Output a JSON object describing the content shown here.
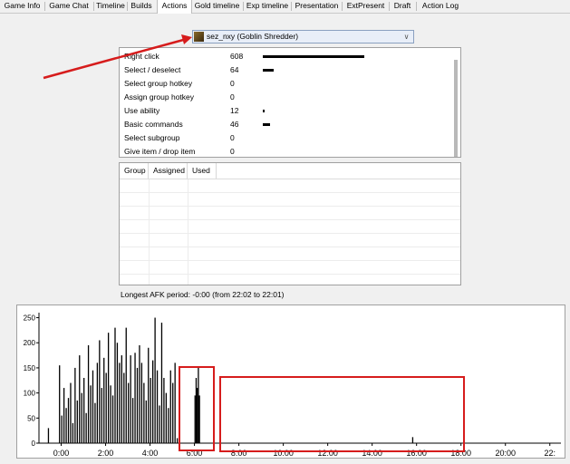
{
  "tabs": [
    "Game Info",
    "Game Chat",
    "Timeline",
    "Builds",
    "Actions",
    "Gold timeline",
    "Exp timeline",
    "Presentation",
    "ExtPresent",
    "Draft",
    "Action Log"
  ],
  "active_tab": "Actions",
  "player_select": {
    "value": "sez_nxy (Goblin Shredder)"
  },
  "actions": [
    {
      "label": "Right click",
      "count": "608",
      "value": 608
    },
    {
      "label": "Select / deselect",
      "count": "64",
      "value": 64
    },
    {
      "label": "Select group hotkey",
      "count": "0",
      "value": 0
    },
    {
      "label": "Assign group hotkey",
      "count": "0",
      "value": 0
    },
    {
      "label": "Use ability",
      "count": "12",
      "value": 12
    },
    {
      "label": "Basic commands",
      "count": "46",
      "value": 46
    },
    {
      "label": "Select subgroup",
      "count": "0",
      "value": 0
    },
    {
      "label": "Give item / drop item",
      "count": "0",
      "value": 0
    }
  ],
  "groups_table": {
    "headers": [
      "Group",
      "Assigned",
      "Used"
    ]
  },
  "afk_label": "Longest AFK period: -0:00 (from 22:02 to 22:01)",
  "colors": {
    "annotation": "#d61c1c",
    "bars": "#000000",
    "tab_active_bg": "#ffffff"
  },
  "chart_data": {
    "type": "bar",
    "ylim": [
      0,
      260
    ],
    "yticks": [
      0,
      50,
      100,
      150,
      200,
      250
    ],
    "xlim": [
      -1,
      22.5
    ],
    "xticks": [
      "0:00",
      "2:00",
      "4:00",
      "6:00",
      "8:00",
      "10:00",
      "12:00",
      "14:00",
      "16:00",
      "18:00",
      "20:00",
      "22:"
    ],
    "grid": false,
    "x": [
      -0.6,
      -0.1,
      0.0,
      0.1,
      0.2,
      0.3,
      0.4,
      0.5,
      0.6,
      0.7,
      0.8,
      0.9,
      1.0,
      1.1,
      1.2,
      1.3,
      1.4,
      1.5,
      1.6,
      1.7,
      1.8,
      1.9,
      2.0,
      2.1,
      2.2,
      2.3,
      2.4,
      2.5,
      2.6,
      2.7,
      2.8,
      2.9,
      3.0,
      3.1,
      3.2,
      3.3,
      3.4,
      3.5,
      3.6,
      3.7,
      3.8,
      3.9,
      4.0,
      4.1,
      4.2,
      4.3,
      4.4,
      4.5,
      4.6,
      4.7,
      4.8,
      4.9,
      5.0,
      5.1,
      5.2,
      6.0,
      6.05,
      6.1,
      6.15,
      6.2,
      15.8
    ],
    "values": [
      30,
      155,
      55,
      110,
      70,
      90,
      120,
      40,
      150,
      85,
      175,
      100,
      130,
      60,
      195,
      115,
      145,
      80,
      160,
      205,
      110,
      170,
      140,
      220,
      115,
      95,
      230,
      200,
      160,
      175,
      140,
      230,
      120,
      175,
      90,
      180,
      150,
      195,
      160,
      120,
      85,
      190,
      130,
      165,
      250,
      145,
      75,
      240,
      130,
      100,
      70,
      145,
      120,
      160,
      10,
      95,
      130,
      110,
      150,
      95,
      12
    ]
  }
}
